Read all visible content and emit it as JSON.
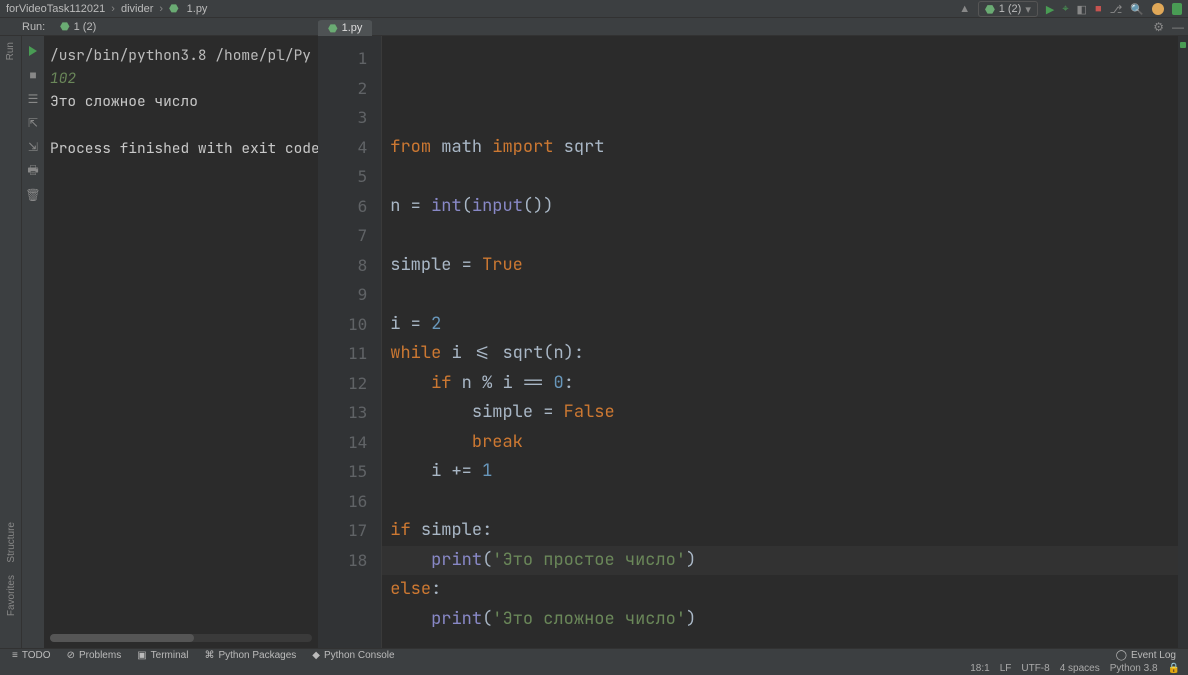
{
  "breadcrumb": {
    "project": "forVideoTask112021",
    "folder": "divider",
    "file": "1.py"
  },
  "run_header": {
    "label": "Run:",
    "config": "1 (2)"
  },
  "tab": {
    "label": "1.py"
  },
  "top_right": {
    "config_label": "1 (2)"
  },
  "console": {
    "path": "/usr/bin/python3.8 /home/pl/Py",
    "input": "102",
    "out": "Это сложное число",
    "exit": "Process finished with exit code"
  },
  "code_lines": [
    {
      "n": 1,
      "html": "<span class='c-kw'>from</span> math <span class='c-kw'>import</span> sqrt"
    },
    {
      "n": 2,
      "html": ""
    },
    {
      "n": 3,
      "html": "n = <span class='c-bi'>int</span>(<span class='c-bi'>input</span>())"
    },
    {
      "n": 4,
      "html": ""
    },
    {
      "n": 5,
      "html": "simple = <span class='c-const'>True</span>"
    },
    {
      "n": 6,
      "html": ""
    },
    {
      "n": 7,
      "html": "i = <span class='c-num'>2</span>"
    },
    {
      "n": 8,
      "html": "<span class='c-kw'>while</span> i &lt;= sqrt(n):"
    },
    {
      "n": 9,
      "html": "    <span class='c-kw'>if</span> n % i == <span class='c-num'>0</span>:"
    },
    {
      "n": 10,
      "html": "        simple = <span class='c-const'>False</span>"
    },
    {
      "n": 11,
      "html": "        <span class='c-kw'>break</span>"
    },
    {
      "n": 12,
      "html": "    i += <span class='c-num'>1</span>"
    },
    {
      "n": 13,
      "html": ""
    },
    {
      "n": 14,
      "html": "<span class='c-kw'>if</span> simple:"
    },
    {
      "n": 15,
      "html": "    <span class='c-bi'>print</span>(<span class='c-str'>'Это простое число'</span>)"
    },
    {
      "n": 16,
      "html": "<span class='c-kw'>else</span>:"
    },
    {
      "n": 17,
      "html": "    <span class='c-bi'>print</span>(<span class='c-str'>'Это сложное число'</span>)"
    },
    {
      "n": 18,
      "html": ""
    }
  ],
  "left_strip": {
    "top": [
      "Run"
    ],
    "bottom": [
      "Favorites",
      "Structure"
    ]
  },
  "bottom_bar": {
    "items": [
      "TODO",
      "Problems",
      "Terminal",
      "Python Packages",
      "Python Console"
    ],
    "event_log": "Event Log"
  },
  "status": {
    "pos": "18:1",
    "eol": "LF",
    "enc": "UTF-8",
    "indent": "4 spaces",
    "py": "Python 3.8"
  }
}
